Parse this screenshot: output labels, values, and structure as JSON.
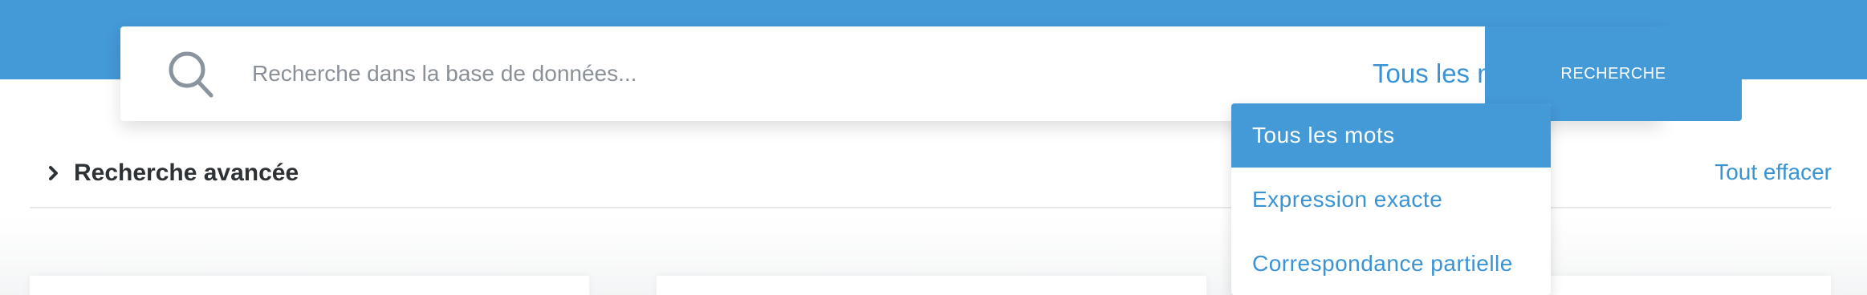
{
  "search": {
    "placeholder": "Recherche dans la base de données...",
    "icon": "search-icon",
    "match_mode": {
      "selected": "Tous les mots",
      "icon": "chevron-up-icon",
      "expanded": true,
      "options": [
        "Tous les mots",
        "Expression exacte",
        "Correspondance partielle"
      ]
    },
    "button_label": "RECHERCHE"
  },
  "advanced": {
    "label": "Recherche avancée",
    "icon": "chevron-right-icon",
    "clear_label": "Tout effacer"
  },
  "colors": {
    "brand_blue": "#4499d7",
    "link_blue": "#3a93d3",
    "text_dark": "#2d3236",
    "placeholder_gray": "#8a9098"
  }
}
